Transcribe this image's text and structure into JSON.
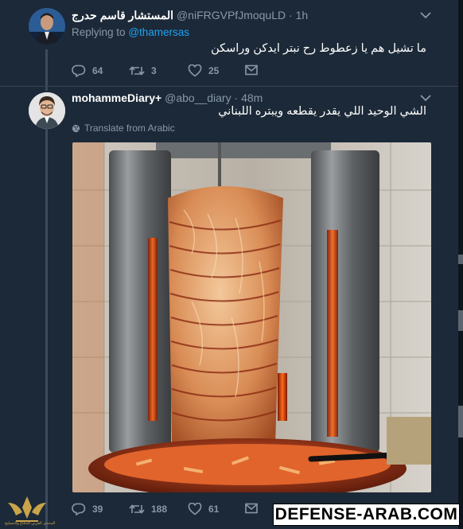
{
  "tweet1": {
    "display_name": "المستشار قاسم حدرج",
    "handle": "@niFRGVPfJmoquLD",
    "time": "1h",
    "replying_label": "Replying to",
    "replying_handle": "@thamersas",
    "text": "ما تشيل هم يا زعطوط رح نبتر ايدكن وراسكن",
    "replies": "64",
    "retweets": "3",
    "likes": "25"
  },
  "tweet2": {
    "display_name": "mohammeDiary+",
    "handle": "@abo__diary",
    "time": "48m",
    "text": "الشي الوحيد اللي يقدر يقطعه ويبتره اللبناني",
    "translate_label": "Translate from Arabic",
    "replies": "39",
    "retweets": "188",
    "likes": "61"
  },
  "watermark": "DEFENSE-ARAB.COM",
  "logo_caption": "المنتدى العربي للدفاع والتسليح",
  "colors": {
    "background": "#1c2938",
    "muted": "#8899a6",
    "link": "#1da1f2",
    "thread_line": "#3b4c5e"
  },
  "icons": [
    "reply-icon",
    "retweet-icon",
    "like-icon",
    "message-icon",
    "chevron-down-icon",
    "globe-icon"
  ]
}
